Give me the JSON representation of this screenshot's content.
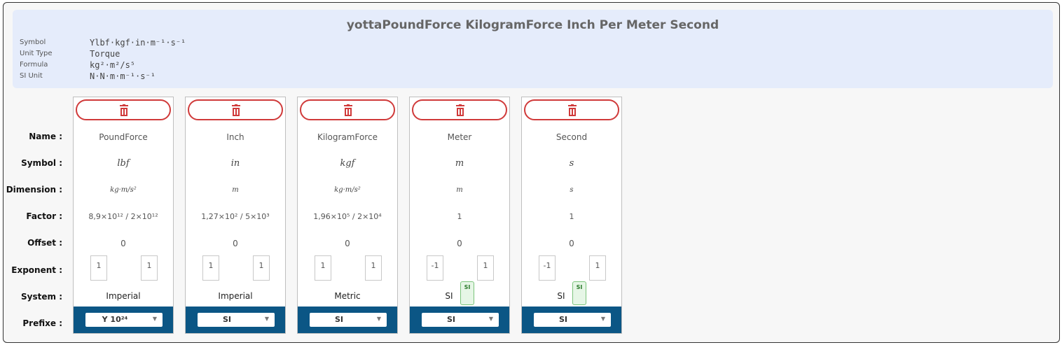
{
  "header": {
    "title": "yottaPoundForce KilogramForce Inch Per Meter Second",
    "meta": [
      {
        "label": "Symbol",
        "value": "Ylbf·kgf·in·m⁻¹·s⁻¹"
      },
      {
        "label": "Unit Type",
        "value": "Torque"
      },
      {
        "label": "Formula",
        "value": "kg²·m²/s⁵"
      },
      {
        "label": "SI Unit",
        "value": "N·N·m·m⁻¹·s⁻¹"
      }
    ]
  },
  "row_labels": {
    "name": "Name :",
    "symbol": "Symbol :",
    "dimension": "Dimension :",
    "factor": "Factor :",
    "offset": "Offset :",
    "exponent": "Exponent :",
    "system": "System :",
    "prefixe": "Prefixe :"
  },
  "cards": [
    {
      "name": "PoundForce",
      "symbol": "lbf",
      "dimension": "kg·m/s²",
      "factor": "8,9×10¹² / 2×10¹²",
      "offset": "0",
      "exp_num": "1",
      "exp_den": "1",
      "system": "Imperial",
      "si_badge": "",
      "prefix": "Y 10²⁴"
    },
    {
      "name": "Inch",
      "symbol": "in",
      "dimension": "m",
      "factor": "1,27×10² / 5×10³",
      "offset": "0",
      "exp_num": "1",
      "exp_den": "1",
      "system": "Imperial",
      "si_badge": "",
      "prefix": "SI"
    },
    {
      "name": "KilogramForce",
      "symbol": "kgf",
      "dimension": "kg·m/s²",
      "factor": "1,96×10⁵ / 2×10⁴",
      "offset": "0",
      "exp_num": "1",
      "exp_den": "1",
      "system": "Metric",
      "si_badge": "",
      "prefix": "SI"
    },
    {
      "name": "Meter",
      "symbol": "m",
      "dimension": "m",
      "factor": "1",
      "offset": "0",
      "exp_num": "-1",
      "exp_den": "1",
      "system": "SI",
      "si_badge": "SI",
      "prefix": "SI"
    },
    {
      "name": "Second",
      "symbol": "s",
      "dimension": "s",
      "factor": "1",
      "offset": "0",
      "exp_num": "-1",
      "exp_den": "1",
      "system": "SI",
      "si_badge": "SI",
      "prefix": "SI"
    }
  ],
  "icons": {
    "delete": "trash-icon",
    "dropdown": "chevron-down-icon"
  },
  "colors": {
    "delete": "#d03a3a",
    "prefix_band": "#0b5685",
    "header_bg": "#e5ecfb",
    "si_badge": "#7bc47b"
  }
}
